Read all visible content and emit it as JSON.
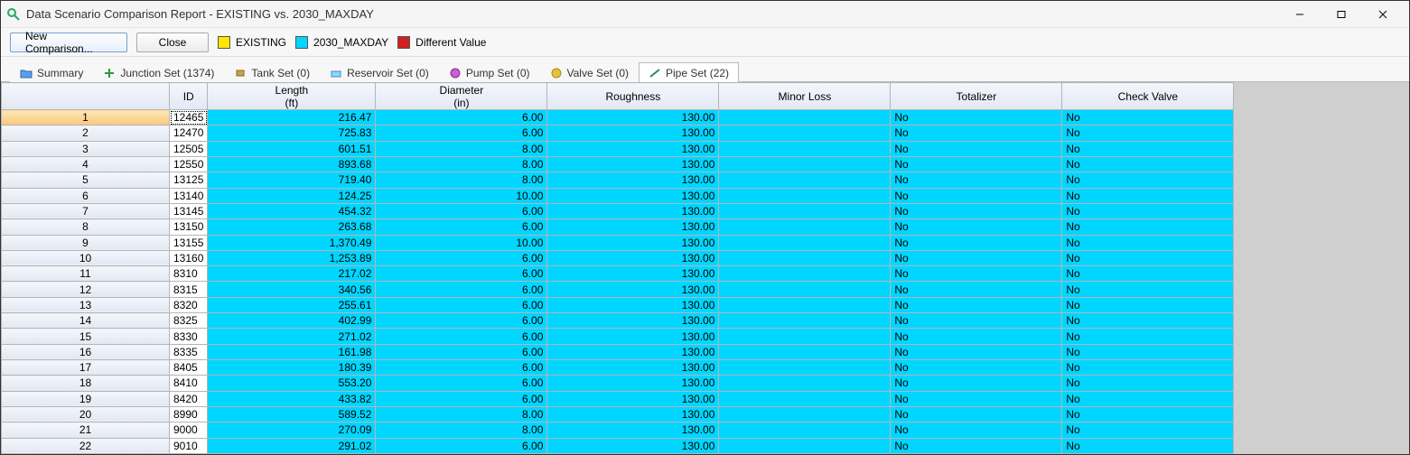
{
  "window": {
    "title": "Data Scenario Comparison Report - EXISTING vs. 2030_MAXDAY"
  },
  "toolbar": {
    "new_comparison_label": "New Comparison...",
    "close_label": "Close"
  },
  "legend": {
    "existing_label": "EXISTING",
    "existing_color": "#ffe600",
    "maxday_label": "2030_MAXDAY",
    "maxday_color": "#00d6ff",
    "different_label": "Different Value",
    "different_color": "#d02020"
  },
  "tabs": {
    "summary": "Summary",
    "junction": "Junction Set (1374)",
    "tank": "Tank Set (0)",
    "reservoir": "Reservoir Set (0)",
    "pump": "Pump Set (0)",
    "valve": "Valve Set (0)",
    "pipe": "Pipe Set (22)"
  },
  "columns": {
    "id": "ID",
    "length": "Length\n(ft)",
    "diameter": "Diameter\n(in)",
    "roughness": "Roughness",
    "minor_loss": "Minor Loss",
    "totalizer": "Totalizer",
    "check_valve": "Check Valve"
  },
  "rows": [
    {
      "n": "1",
      "id": "12465",
      "length": "216.47",
      "diameter": "6.00",
      "roughness": "130.00",
      "minor_loss": "",
      "totalizer": "No",
      "check_valve": "No"
    },
    {
      "n": "2",
      "id": "12470",
      "length": "725.83",
      "diameter": "6.00",
      "roughness": "130.00",
      "minor_loss": "",
      "totalizer": "No",
      "check_valve": "No"
    },
    {
      "n": "3",
      "id": "12505",
      "length": "601.51",
      "diameter": "8.00",
      "roughness": "130.00",
      "minor_loss": "",
      "totalizer": "No",
      "check_valve": "No"
    },
    {
      "n": "4",
      "id": "12550",
      "length": "893.68",
      "diameter": "8.00",
      "roughness": "130.00",
      "minor_loss": "",
      "totalizer": "No",
      "check_valve": "No"
    },
    {
      "n": "5",
      "id": "13125",
      "length": "719.40",
      "diameter": "8.00",
      "roughness": "130.00",
      "minor_loss": "",
      "totalizer": "No",
      "check_valve": "No"
    },
    {
      "n": "6",
      "id": "13140",
      "length": "124.25",
      "diameter": "10.00",
      "roughness": "130.00",
      "minor_loss": "",
      "totalizer": "No",
      "check_valve": "No"
    },
    {
      "n": "7",
      "id": "13145",
      "length": "454.32",
      "diameter": "6.00",
      "roughness": "130.00",
      "minor_loss": "",
      "totalizer": "No",
      "check_valve": "No"
    },
    {
      "n": "8",
      "id": "13150",
      "length": "263.68",
      "diameter": "6.00",
      "roughness": "130.00",
      "minor_loss": "",
      "totalizer": "No",
      "check_valve": "No"
    },
    {
      "n": "9",
      "id": "13155",
      "length": "1,370.49",
      "diameter": "10.00",
      "roughness": "130.00",
      "minor_loss": "",
      "totalizer": "No",
      "check_valve": "No"
    },
    {
      "n": "10",
      "id": "13160",
      "length": "1,253.89",
      "diameter": "6.00",
      "roughness": "130.00",
      "minor_loss": "",
      "totalizer": "No",
      "check_valve": "No"
    },
    {
      "n": "11",
      "id": "8310",
      "length": "217.02",
      "diameter": "6.00",
      "roughness": "130.00",
      "minor_loss": "",
      "totalizer": "No",
      "check_valve": "No"
    },
    {
      "n": "12",
      "id": "8315",
      "length": "340.56",
      "diameter": "6.00",
      "roughness": "130.00",
      "minor_loss": "",
      "totalizer": "No",
      "check_valve": "No"
    },
    {
      "n": "13",
      "id": "8320",
      "length": "255.61",
      "diameter": "6.00",
      "roughness": "130.00",
      "minor_loss": "",
      "totalizer": "No",
      "check_valve": "No"
    },
    {
      "n": "14",
      "id": "8325",
      "length": "402.99",
      "diameter": "6.00",
      "roughness": "130.00",
      "minor_loss": "",
      "totalizer": "No",
      "check_valve": "No"
    },
    {
      "n": "15",
      "id": "8330",
      "length": "271.02",
      "diameter": "6.00",
      "roughness": "130.00",
      "minor_loss": "",
      "totalizer": "No",
      "check_valve": "No"
    },
    {
      "n": "16",
      "id": "8335",
      "length": "161.98",
      "diameter": "6.00",
      "roughness": "130.00",
      "minor_loss": "",
      "totalizer": "No",
      "check_valve": "No"
    },
    {
      "n": "17",
      "id": "8405",
      "length": "180.39",
      "diameter": "6.00",
      "roughness": "130.00",
      "minor_loss": "",
      "totalizer": "No",
      "check_valve": "No"
    },
    {
      "n": "18",
      "id": "8410",
      "length": "553.20",
      "diameter": "6.00",
      "roughness": "130.00",
      "minor_loss": "",
      "totalizer": "No",
      "check_valve": "No"
    },
    {
      "n": "19",
      "id": "8420",
      "length": "433.82",
      "diameter": "6.00",
      "roughness": "130.00",
      "minor_loss": "",
      "totalizer": "No",
      "check_valve": "No"
    },
    {
      "n": "20",
      "id": "8990",
      "length": "589.52",
      "diameter": "8.00",
      "roughness": "130.00",
      "minor_loss": "",
      "totalizer": "No",
      "check_valve": "No"
    },
    {
      "n": "21",
      "id": "9000",
      "length": "270.09",
      "diameter": "8.00",
      "roughness": "130.00",
      "minor_loss": "",
      "totalizer": "No",
      "check_valve": "No"
    },
    {
      "n": "22",
      "id": "9010",
      "length": "291.02",
      "diameter": "6.00",
      "roughness": "130.00",
      "minor_loss": "",
      "totalizer": "No",
      "check_valve": "No"
    }
  ]
}
